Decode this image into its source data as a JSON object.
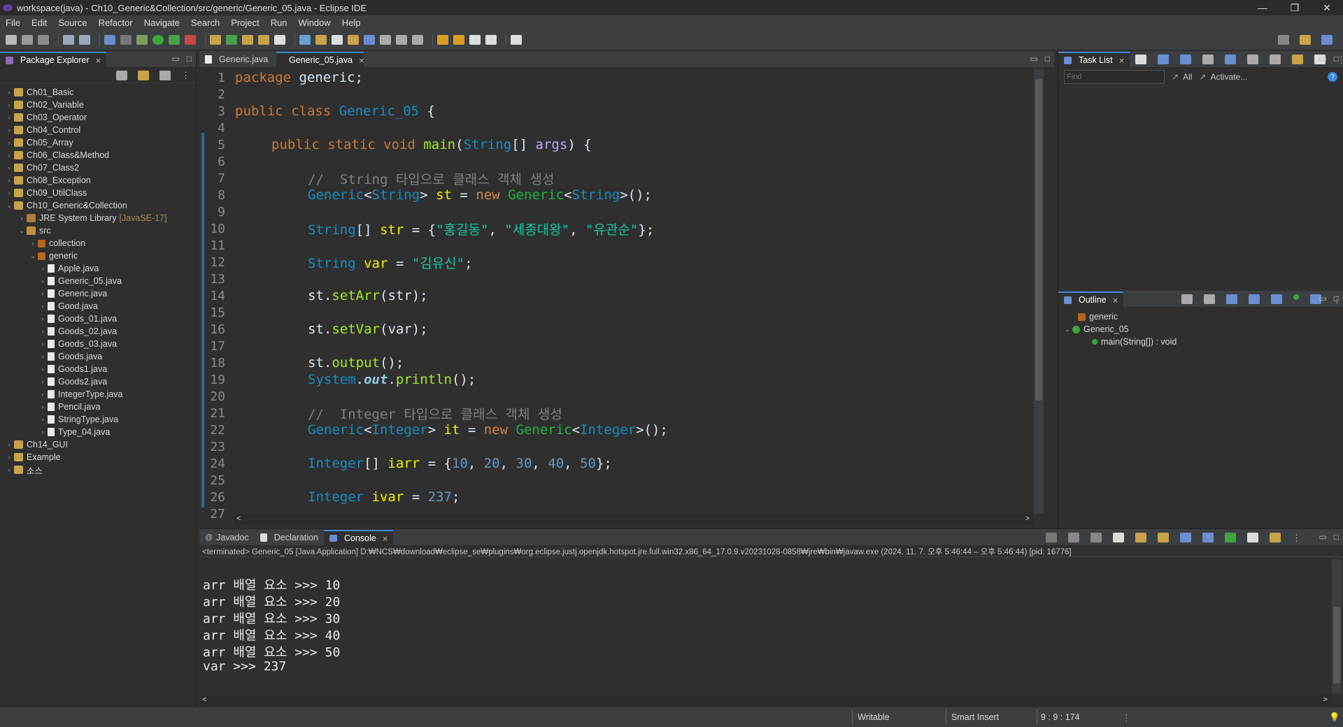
{
  "window": {
    "title": "workspace(java) - Ch10_Generic&Collection/src/generic/Generic_05.java - Eclipse IDE",
    "controls": [
      "—",
      "❐",
      "✕"
    ]
  },
  "menu": [
    "File",
    "Edit",
    "Source",
    "Refactor",
    "Navigate",
    "Search",
    "Project",
    "Run",
    "Window",
    "Help"
  ],
  "package_explorer": {
    "title": "Package Explorer",
    "projects_top": [
      "Ch01_Basic",
      "Ch02_Variable",
      "Ch03_Operator",
      "Ch04_Control",
      "Ch05_Array",
      "Ch06_Class&Method",
      "Ch07_Class2",
      "Ch08_Exception",
      "Ch09_UtilClass"
    ],
    "open_project": "Ch10_Generic&Collection",
    "jre": "JRE System Library",
    "jre_tag": "[JavaSE-17]",
    "src": "src",
    "pkg_collection": "collection",
    "pkg_generic": "generic",
    "files": [
      "Apple.java",
      "Generic_05.java",
      "Generic.java",
      "Good.java",
      "Goods_01.java",
      "Goods_02.java",
      "Goods_03.java",
      "Goods.java",
      "Goods1.java",
      "Goods2.java",
      "IntegerType.java",
      "Pencil.java",
      "StringType.java",
      "Type_04.java"
    ],
    "projects_bottom": [
      "Ch14_GUI",
      "Example",
      "소스"
    ]
  },
  "editor": {
    "tabs": [
      "Generic.java",
      "Generic_05.java"
    ],
    "line_numbers": [
      "1",
      "2",
      "3",
      "4",
      "5",
      "6",
      "7",
      "8",
      "9",
      "10",
      "11",
      "12",
      "13",
      "14",
      "15",
      "16",
      "17",
      "18",
      "19",
      "20",
      "21",
      "22",
      "23",
      "24",
      "25",
      "26",
      "27"
    ],
    "tokens": {
      "package": "package",
      "generic": " generic;",
      "public": "public",
      "class": " class ",
      "Generic_05": "Generic_05",
      "brace_open": " {",
      "static_void": " static void ",
      "main": "main",
      "paren": "(",
      "String": "String",
      "arr_args": "[] ",
      "args": "args",
      "close_main": ") {",
      "comment1": "//  String 타입으로 클래스 객체 생성",
      "Generic": "Generic",
      "lt": "<",
      "gt_st": "> ",
      "st": "st",
      "eq": " = ",
      "new": "new",
      "gt_call": ">();",
      "arr_str": "[] ",
      "str": "str",
      "eq_brace": " = {",
      "s1": "\"홍길동\"",
      "comma": ", ",
      "s2": "\"세종대왕\"",
      "s3": "\"유관순\"",
      "end_brace": "};",
      "var": "var",
      "s_kim": "\"김유신\"",
      "semi": ";",
      "dot": ".",
      "setArr": "setArr",
      "open": "(",
      "close": ");",
      "setVar": "setVar",
      "output": "output",
      "empty_call": "();",
      "System": "System",
      "out": "out",
      "println": "println",
      "comment2": "//  Integer 타입으로 클래스 객체 생성",
      "Integer": "Integer",
      "it": "it",
      "iarr": "iarr",
      "n10": "10",
      "n20": "20",
      "n30": "30",
      "n40": "40",
      "n50": "50",
      "ivar": "ivar",
      "n237": "237"
    }
  },
  "task_list": {
    "title": "Task List",
    "find_placeholder": "Find",
    "all": "All",
    "activate": "Activate..."
  },
  "outline": {
    "title": "Outline",
    "package": "generic",
    "class": "Generic_05",
    "method": "main(String[]) : void"
  },
  "console": {
    "tabs": [
      "Javadoc",
      "Declaration",
      "Console"
    ],
    "status": "<terminated> Generic_05 [Java Application] D:₩NCS₩download₩eclipse_se₩plugins₩org.eclipse.justj.openjdk.hotspot.jre.full.win32.x86_64_17.0.9.v20231028-0858₩jre₩bin₩javaw.exe  (2024. 11. 7. 오후 5:46:44 – 오후 5:46:44) [pid: 16776]",
    "output": [
      "arr 배열 요소 >>> 10",
      "arr 배열 요소 >>> 20",
      "arr 배열 요소 >>> 30",
      "arr 배열 요소 >>> 40",
      "arr 배열 요소 >>> 50",
      "var >>> 237"
    ]
  },
  "status": {
    "writable": "Writable",
    "insert_mode": "Smart Insert",
    "position": "9 : 9 : 174"
  },
  "colors": {
    "accent": "#3a8ae0",
    "background": "#2f2f2f",
    "chrome": "#3c3f41"
  }
}
